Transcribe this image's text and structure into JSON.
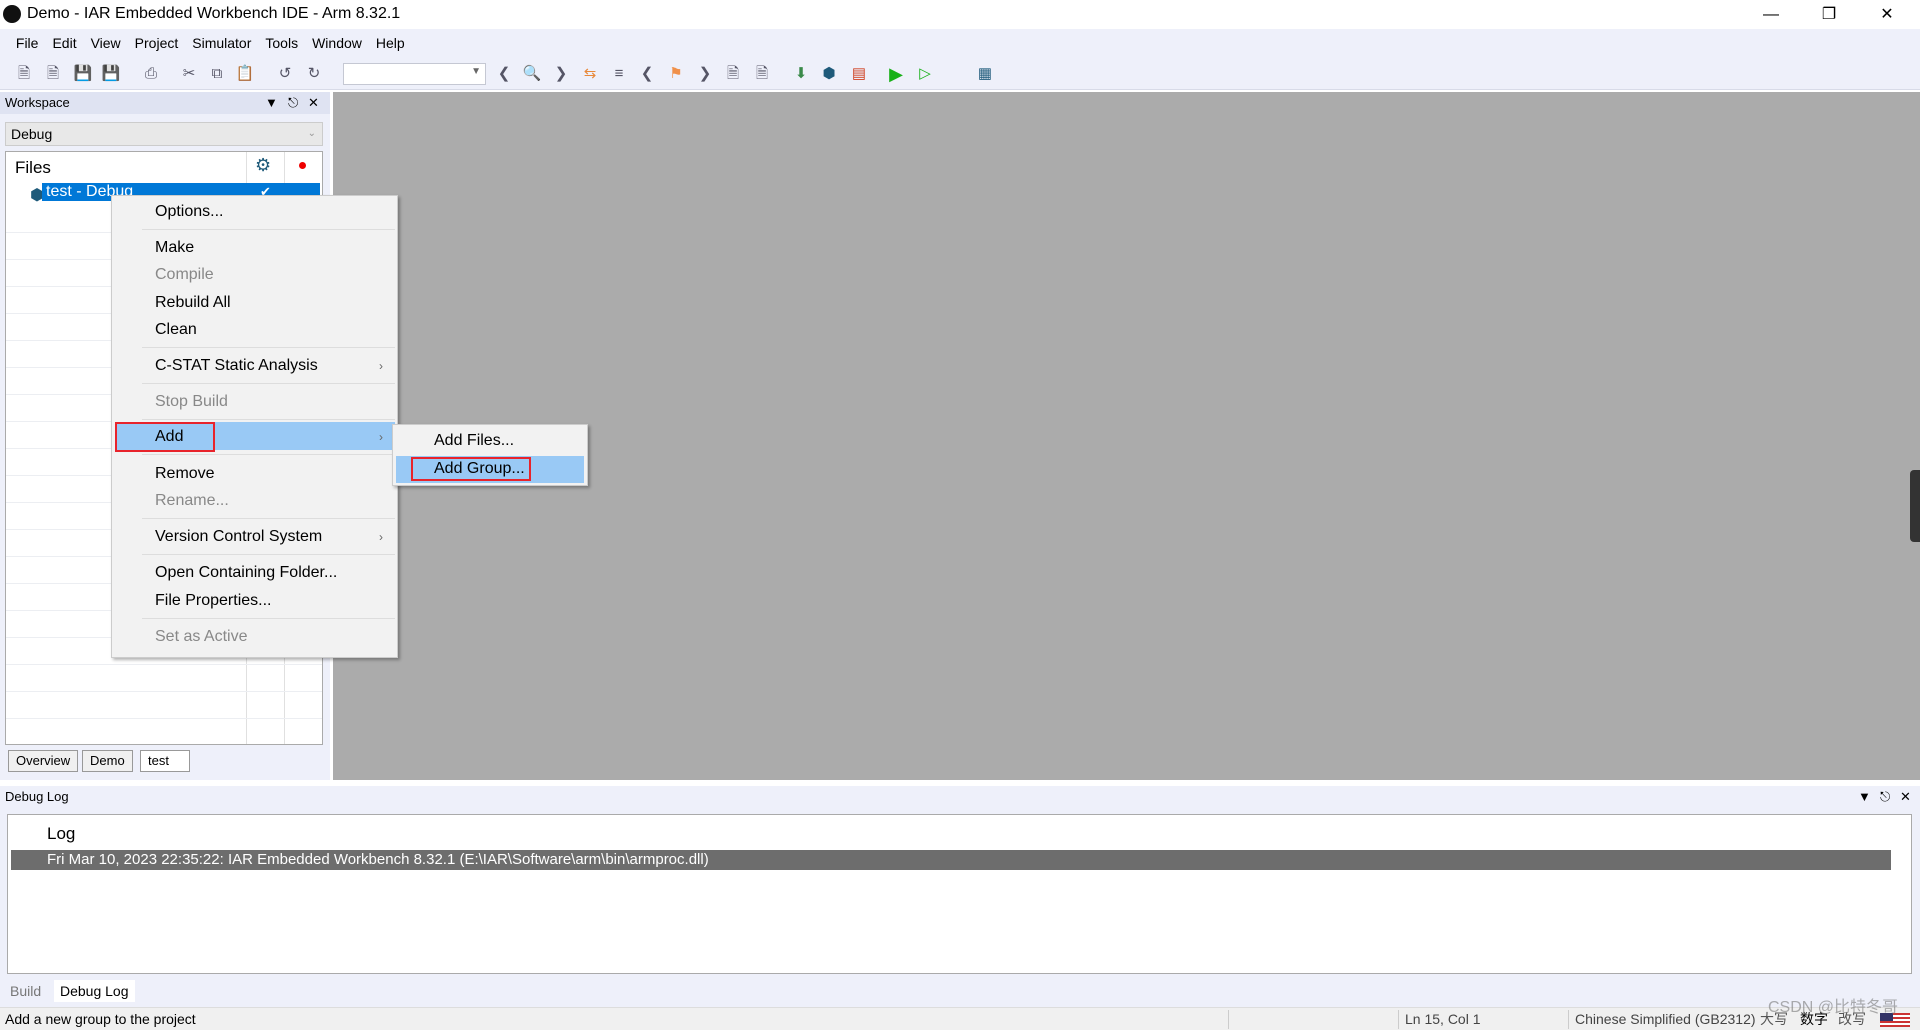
{
  "window": {
    "title": "Demo - IAR Embedded Workbench IDE - Arm 8.32.1"
  },
  "menu": [
    "File",
    "Edit",
    "View",
    "Project",
    "Simulator",
    "Tools",
    "Window",
    "Help"
  ],
  "workspace": {
    "title": "Workspace",
    "config": "Debug",
    "files_header": "Files",
    "project": "test - Debug",
    "tabs": [
      "Overview",
      "Demo",
      "test"
    ]
  },
  "context_menu": {
    "items": [
      "Options...",
      "Make",
      "Compile",
      "Rebuild All",
      "Clean",
      "C-STAT Static Analysis",
      "Stop Build",
      "Add",
      "Remove",
      "Rename...",
      "Version Control System",
      "Open Containing Folder...",
      "File Properties...",
      "Set as Active"
    ]
  },
  "submenu": {
    "items": [
      "Add Files...",
      "Add Group..."
    ]
  },
  "debug_log": {
    "title": "Debug Log",
    "column": "Log",
    "entry": "Fri Mar 10, 2023 22:35:22: IAR Embedded Workbench 8.32.1 (E:\\IAR\\Software\\arm\\bin\\armproc.dll)",
    "tabs": [
      "Build",
      "Debug Log"
    ]
  },
  "status": {
    "message": "Add a new group to the project",
    "position": "Ln 15, Col 1",
    "encoding": "Chinese Simplified (GB2312)",
    "caps": "大写",
    "num": "数字",
    "ovr": "改写",
    "watermark": "CSDN @比特冬哥"
  },
  "colors": {
    "selection": "#0078d7",
    "highlight": "#99c9f5",
    "annotation": "#e8232b"
  }
}
